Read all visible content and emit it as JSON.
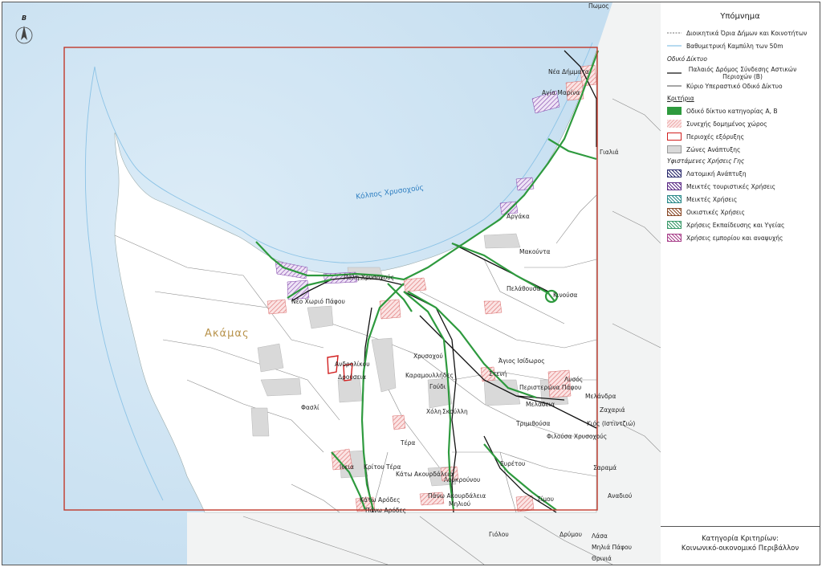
{
  "map": {
    "north_label": "B",
    "sea_label": "Κόλπος Χρυσοχούς",
    "area_label": "Ακάμας",
    "places": {
      "pomos": "Πωμος",
      "nea_dimmata": "Νέα Δήμματα",
      "agia_marina": "Αγία Μαρίνα",
      "gialia": "Γιαλιά",
      "argaka": "Αργάκα",
      "makounta": "Μακούντα",
      "pelathousa": "Πελάθουσα",
      "kinousa": "Κινούσα",
      "polis": "Πόλη Χρυσοχούς",
      "neo_chorio": "Νέο Χωριό Πάφου",
      "androlikou": "Ανδρολίκου",
      "droushia": "Δρούσεια",
      "fasli": "Φασλί",
      "chrysochou": "Χρυσοχού",
      "agios_isidoros": "Άγιος Ισίδωρος",
      "steni": "Στενή",
      "karamoullides": "Καραμουλλήδες",
      "goudi": "Γούδι",
      "choli": "Χόλη",
      "skoulli": "Σκούλλη",
      "peristerona": "Περιστερώνα Πάφου",
      "lysos": "Λυσός",
      "meladeia": "Μελάδεια",
      "melandra": "Μελάνδρα",
      "zacharia": "Ζαχαριά",
      "kios": "Κιός (Ιστιντζιώ)",
      "trimithousa": "Τριμιθούσα",
      "filousa": "Φιλούσα Χρυσοχούς",
      "tera": "Τέρα",
      "ineia": "Ινεια",
      "kritou_tera": "Κρίτου Τέρα",
      "kato_akourdaleia": "Κάτω Ακουρδάλεια",
      "evretou": "Ευρέτου",
      "sarama": "Σαραμά",
      "loukrounou": "Λουκρούνου",
      "anadiou": "Αναδιού",
      "pano_akourdaleia": "Πάνω Ακουρδάλεια",
      "miliou": "Μηλιού",
      "simou": "Σίμου",
      "kato_arodes": "Κάτω Αρόδες",
      "pano_arodes": "Πάνω Αρόδες",
      "giolou": "Γιόλου",
      "drymou": "Δρύμου",
      "lasa": "Λάσα",
      "milia_pafou": "Μηλιά Πάφου",
      "thrinia": "Θρινιά"
    }
  },
  "legend": {
    "title": "Υπόμνημα",
    "admin_boundaries": "Διοικητικά Όρια Δήμων και Κοινοτήτων",
    "bathymetric": "Βαθυμετρική Καμπύλη των 50m",
    "road_network_head": "Οδικό Δίκτυο",
    "old_road": "Παλαιός Δρόμος Σύνδεσης Αστικών Περιοχών (Β)",
    "main_road": "Κύριο Υπεραστικό Οδικό Δίκτυο",
    "criteria_head": "Κριτήρια",
    "road_ab": "Οδικό δίκτυο κατηγορίας Α, Β",
    "built_area": "Συνεχής δομημένος χώρος",
    "quarry": "Περιοχές εξόρυξης",
    "dev_zones": "Ζώνες Ανάπτυξης",
    "land_use_head": "Υφιστάμενες Χρήσεις Γης",
    "lu_quarry_dev": "Λατομική Ανάπτυξη",
    "lu_mixed_tourist": "Μεικτές τουριστικές Χρήσεις",
    "lu_mixed": "Μεικτές Χρήσεις",
    "lu_residential": "Οικιστικές Χρήσεις",
    "lu_education": "Χρήσεις Εκπαίδευσης και Υγείας",
    "lu_commerce": "Χρήσεις εμπορίου και αναψυχής"
  },
  "category_box": {
    "line1": "Κατηγορία Κριτηρίων:",
    "line2": "Κοινωνικό-οικονομικό Περιβάλλον"
  },
  "colors": {
    "sea": "#d3e7f3",
    "road_ab": "#2e9a3e",
    "quarry_outline": "#d22020",
    "study_frame": "#c0392b",
    "dev_zone": "#d9d9d9"
  }
}
